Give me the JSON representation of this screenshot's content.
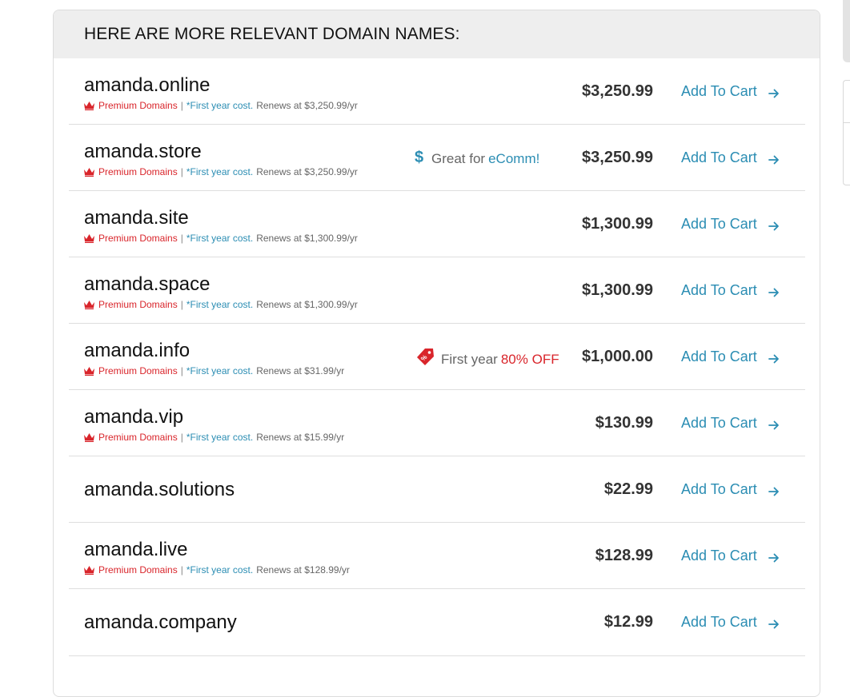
{
  "header": {
    "title": "HERE ARE MORE RELEVANT DOMAIN NAMES:"
  },
  "labels": {
    "premium": "Premium Domains",
    "separator": "|",
    "first_year": "*First year cost.",
    "add_to_cart": "Add To Cart"
  },
  "colors": {
    "accent": "#2b8db3",
    "premium_red": "#d9252b",
    "price": "#333333"
  },
  "domains": [
    {
      "name": "amanda.online",
      "price": "$3,250.99",
      "premium": true,
      "renews": "Renews at $3,250.99/yr",
      "promo": null
    },
    {
      "name": "amanda.store",
      "price": "$3,250.99",
      "premium": true,
      "renews": "Renews at $3,250.99/yr",
      "promo": {
        "icon": "dollar-icon",
        "text": "Great for",
        "accent": "eComm!"
      }
    },
    {
      "name": "amanda.site",
      "price": "$1,300.99",
      "premium": true,
      "renews": "Renews at $1,300.99/yr",
      "promo": null
    },
    {
      "name": "amanda.space",
      "price": "$1,300.99",
      "premium": true,
      "renews": "Renews at $1,300.99/yr",
      "promo": null
    },
    {
      "name": "amanda.info",
      "price": "$1,000.00",
      "premium": true,
      "renews": "Renews at $31.99/yr",
      "promo": {
        "icon": "sale-tag-icon",
        "text": "First year",
        "accent": "80% OFF"
      }
    },
    {
      "name": "amanda.vip",
      "price": "$130.99",
      "premium": true,
      "renews": "Renews at $15.99/yr",
      "promo": null
    },
    {
      "name": "amanda.solutions",
      "price": "$22.99",
      "premium": false,
      "renews": null,
      "promo": null
    },
    {
      "name": "amanda.live",
      "price": "$128.99",
      "premium": true,
      "renews": "Renews at $128.99/yr",
      "promo": null
    },
    {
      "name": "amanda.company",
      "price": "$12.99",
      "premium": false,
      "renews": null,
      "promo": null
    }
  ]
}
